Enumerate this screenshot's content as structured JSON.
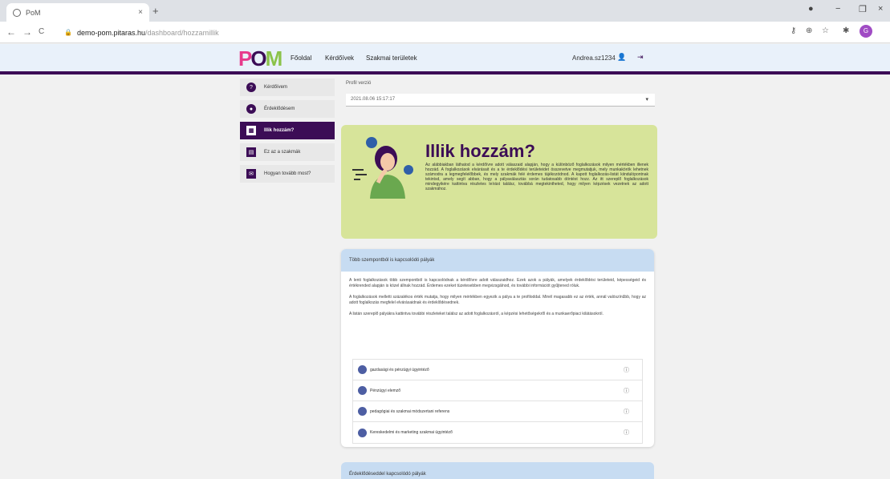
{
  "browser": {
    "tab_title": "PoM",
    "tab_close": "×",
    "new_tab": "+",
    "url_host": "demo-pom.pitaras.hu",
    "url_path": "/dashboard/hozzamillik",
    "lock": "🔒",
    "back": "←",
    "forward": "→",
    "reload": "C",
    "profile_initial": "G",
    "ext_icons": [
      "⚷",
      "⊕",
      "☆",
      "✱"
    ],
    "window_controls": [
      "●",
      "−",
      "❐",
      "×"
    ]
  },
  "header": {
    "logo": {
      "p": "P",
      "o": "O",
      "m": "M"
    },
    "nav": [
      "Főoldal",
      "Kérdőívek",
      "Szakmai területek"
    ],
    "user_name": "Andrea.sz1234",
    "user_icon": "👤",
    "logout_icon": "⇥"
  },
  "sidebar": {
    "items": [
      {
        "label": "Kérdőívem",
        "icon": "?",
        "active": false
      },
      {
        "label": "Érdeklődésem",
        "icon": "●",
        "active": false
      },
      {
        "label": "Illik hozzám?",
        "icon": "▦",
        "active": true
      },
      {
        "label": "Ez az a szakmák",
        "icon": "▤",
        "active": false
      },
      {
        "label": "Hogyan tovább most?",
        "icon": "✉",
        "active": false
      }
    ]
  },
  "main": {
    "profile_label": "Profil verzió",
    "profile_value": "2021.08.06 15:17:17",
    "caret": "▾",
    "hero": {
      "title": "Illik hozzám?",
      "text": "Az alábbiakban láthatod a kérdőívre adott válaszaid alapján, hogy a különböző foglalkozások milyen mértékben illenek hozzád. A foglalkozások elvárásait és a te érdeklődési területeidet összevetve megmutatjuk, mely munkakörök lehetnek számodra a legmegfelelőbbek, és mely szakmák felé érdemes tájékozódnod. A kapott foglalkozás-listát kiindulópontnak tekintsd, amely segít abban, hogy a pályaválasztás során tudatosabb döntést hozz. Az itt szereplő foglalkozások mindegyikére kattintva részletes leírást találsz, továbbá megtekintheted, hogy milyen képzések vezetnek az adott szakmához."
    },
    "card": {
      "header": "Több szempontból is kapcsolódó pályák",
      "paragraphs": [
        "A lenti foglalkozások több szempontból is kapcsolódnak a kérdőívre adott válaszaidhoz. Ezek azok a pályák, amelyek érdeklődési területeid, képességeid és értékrended alapján is közel állnak hozzád. Érdemes ezeket tüzetesebben megvizsgálnod, és további információt gyűjtened róluk.",
        "A foglalkozások melletti százalékos érték mutatja, hogy milyen mértékben egyezik a pálya a te profiloddal. Minél magasabb ez az érték, annál valószínűbb, hogy az adott foglalkozás megfelel elvárásaidnak és érdeklődésednek.",
        "A listán szereplő pályákra kattintva további részleteket találsz az adott foglalkozásról, a képzési lehetőségekről és a munkaerőpiaci kilátásokról."
      ],
      "jobs": [
        {
          "label": "gazdasági és pénzügyi ügyintéző",
          "info": "ⓘ"
        },
        {
          "label": "Pénzügyi elemző",
          "info": "ⓘ"
        },
        {
          "label": "pedagógiai és szakmai módszertani referens",
          "info": "ⓘ"
        },
        {
          "label": "Kereskedelmi és marketing szakmai ügyintéző",
          "info": "ⓘ"
        }
      ]
    },
    "card2_header": "Érdeklődéseddel kapcsolódó pályák"
  }
}
